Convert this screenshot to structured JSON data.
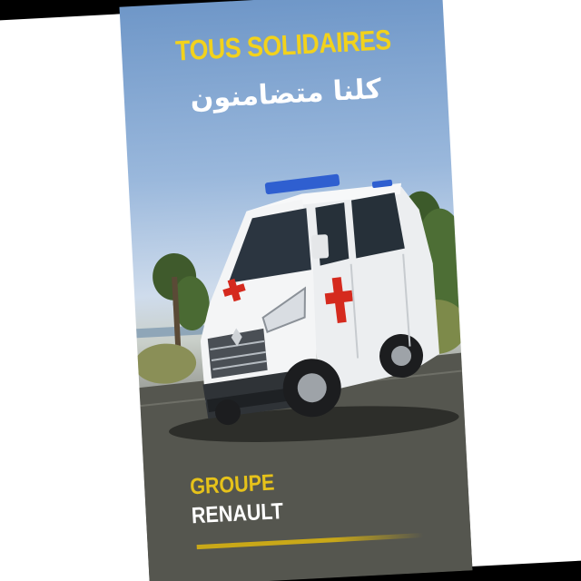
{
  "poster": {
    "headline_fr": "TOUS SOLIDAIRES",
    "headline_ar": "كلنا متضامنون",
    "brand_line1": "GROUPE",
    "brand_line2": "RENAULT"
  },
  "colors": {
    "headline_yellow": "#f2d21c",
    "brand_yellow": "#e6c21a",
    "van_white": "#f4f5f6",
    "cross_red": "#d52a1e",
    "siren_blue": "#2f5fd0"
  },
  "icons": {
    "medical_cross": "red-cross-icon"
  }
}
